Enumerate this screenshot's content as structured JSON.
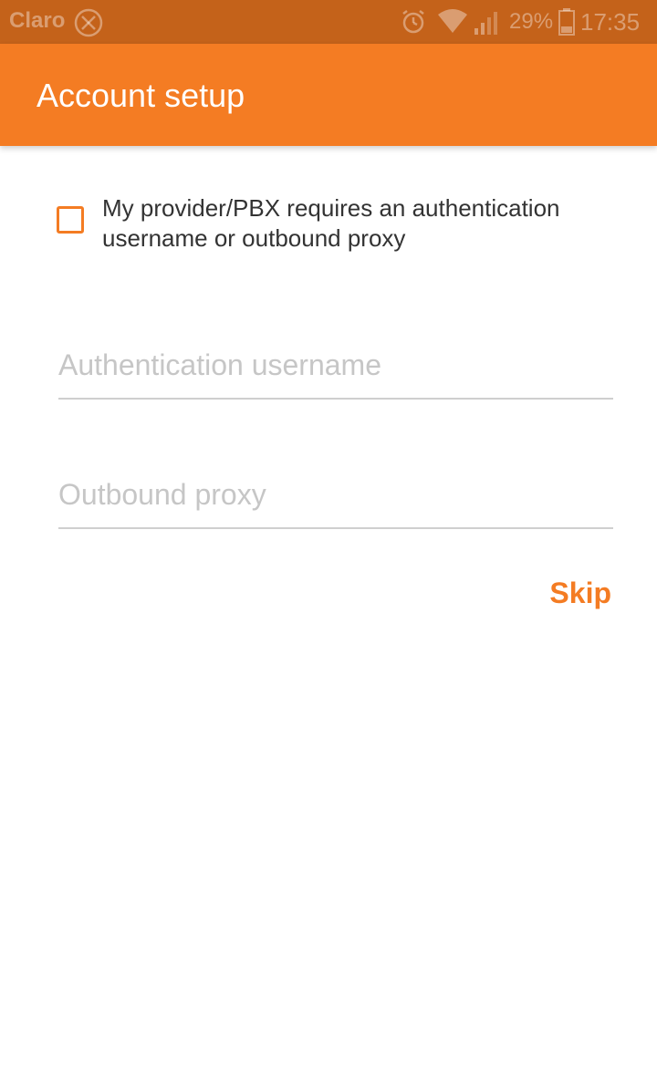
{
  "status_bar": {
    "carrier": "Claro",
    "battery_percent": "29%",
    "time": "17:35",
    "icons": [
      "no-sim-icon",
      "alarm-icon",
      "wifi-icon",
      "signal-icon",
      "battery-icon"
    ]
  },
  "app_bar": {
    "title": "Account setup"
  },
  "form": {
    "checkbox_label": "My provider/PBX requires an authentication username or outbound proxy",
    "checkbox_checked": false,
    "auth_username": {
      "value": "",
      "placeholder": "Authentication username"
    },
    "outbound_proxy": {
      "value": "",
      "placeholder": "Outbound proxy"
    },
    "skip_label": "Skip"
  },
  "colors": {
    "accent": "#f47c23",
    "status_bar": "#c4621a"
  }
}
